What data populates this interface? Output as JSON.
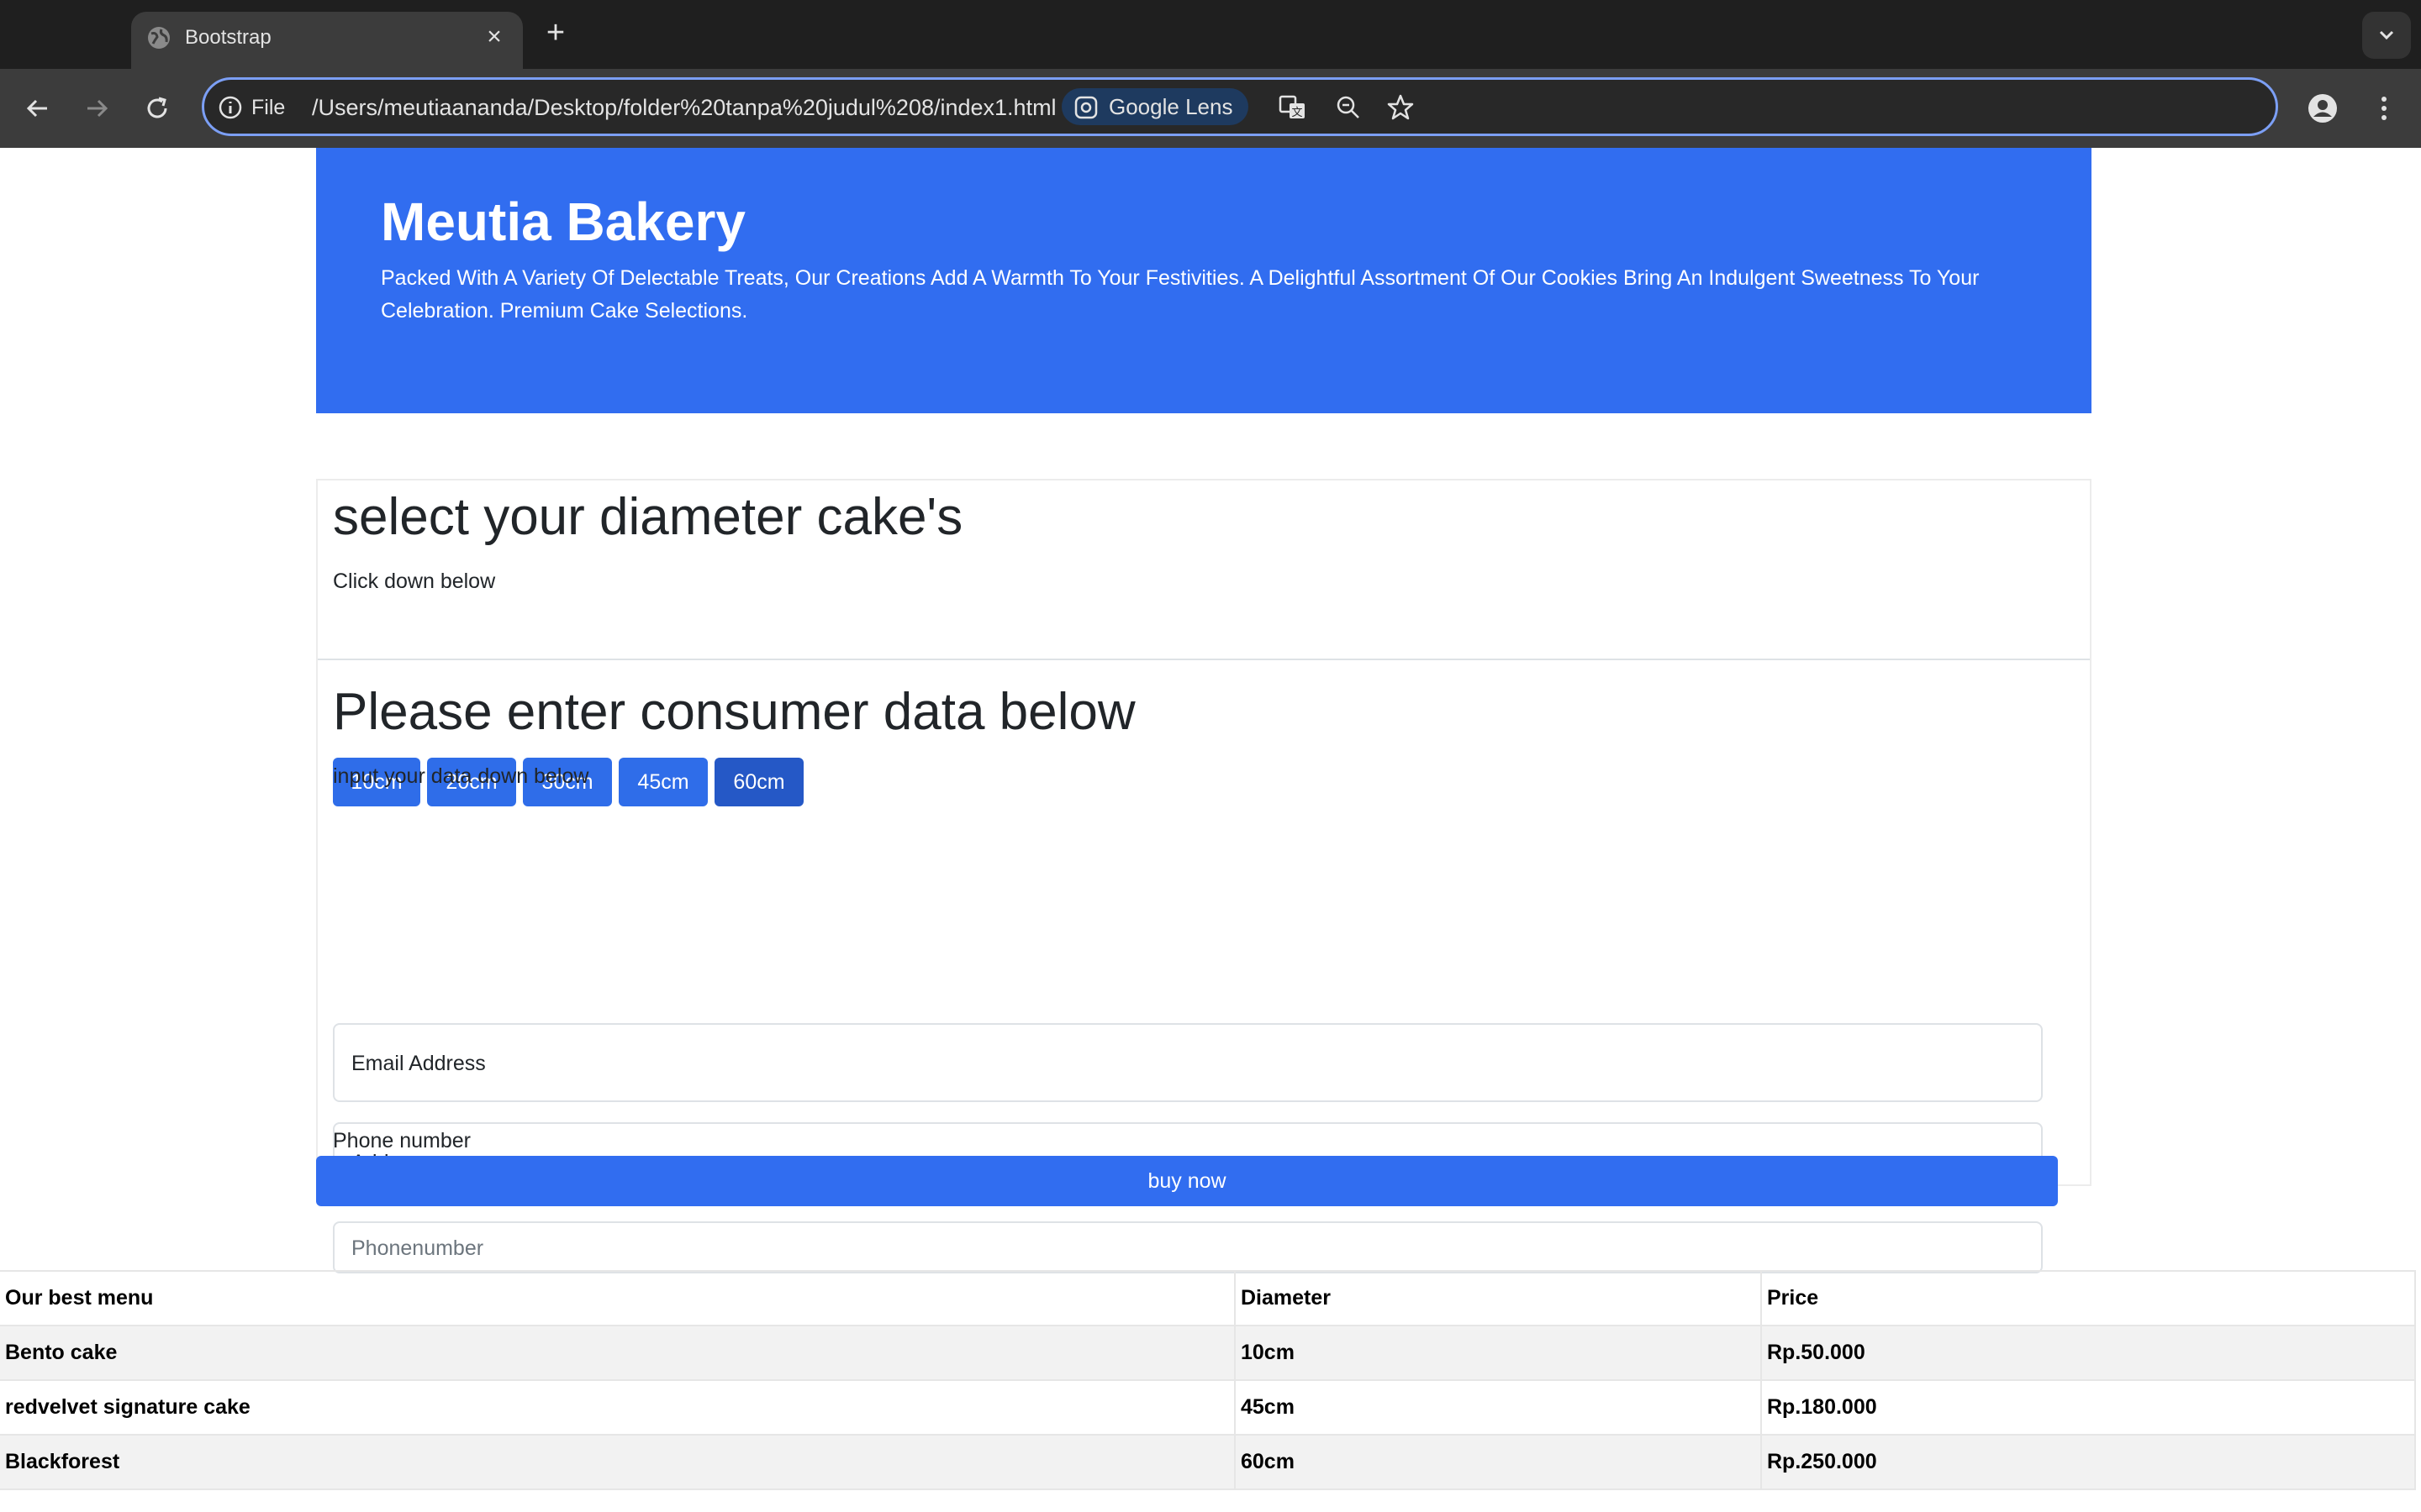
{
  "browser": {
    "tab_title": "Bootstrap",
    "site_info_label": "File",
    "url": "/Users/meutiaananda/Desktop/folder%20tanpa%20judul%208/index1.html",
    "lens_label": "Google Lens",
    "icons": [
      "globe-icon",
      "close-icon",
      "plus-icon",
      "chevron-down-icon",
      "back-icon",
      "forward-icon",
      "reload-icon",
      "info-icon",
      "lens-icon",
      "translate-icon",
      "zoom-icon",
      "star-icon",
      "profile-icon",
      "more-icon"
    ]
  },
  "hero": {
    "title": "Meutia Bakery",
    "text": "Packed With A Variety Of Delectable Treats, Our Creations Add A Warmth To Your Festivities. A Delightful Assortment Of Our Cookies Bring An Indulgent Sweetness To Your Celebration. Premium Cake Selections.",
    "color": "#316df0"
  },
  "diameter_section": {
    "heading": "select your diameter cake's",
    "subtext": "Click down below",
    "buttons": [
      "10cm",
      "20cm",
      "30cm",
      "45cm",
      "60cm"
    ]
  },
  "consumer_section": {
    "heading": "Please enter consumer data below",
    "subtext": "input your data down below",
    "email_label": "Email Address",
    "address_label": "Address",
    "phone_placeholder": "Phonenumber",
    "phone_label": "Phone number",
    "buy_button": "buy now"
  },
  "menu_table": {
    "headers": [
      "Our best menu",
      "Diameter",
      "Price"
    ],
    "rows": [
      [
        "Bento cake",
        "10cm",
        "Rp.50.000"
      ],
      [
        "redvelvet signature cake",
        "45cm",
        "Rp.180.000"
      ],
      [
        "Blackforest",
        "60cm",
        "Rp.250.000"
      ]
    ]
  }
}
